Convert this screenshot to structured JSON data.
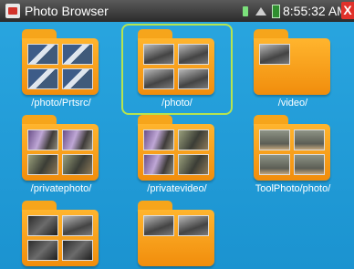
{
  "window": {
    "title": "Photo Browser",
    "clock": "8:55:32 AM",
    "close_label": "X"
  },
  "status_icons": [
    "sd-card-icon",
    "network-icon",
    "battery-icon"
  ],
  "colors": {
    "background": "#1e9ad6",
    "folder": "#f6a51b",
    "selection": "#b6e44f",
    "titlebar": "#3a3a3a",
    "close": "#e0312a"
  },
  "folders": [
    {
      "label": "/photo/Prtsrc/",
      "selected": false,
      "thumbs": [
        "screen",
        "screen",
        "screen",
        "screen"
      ]
    },
    {
      "label": "/photo/",
      "selected": true,
      "thumbs": [
        "cctv",
        "cctv",
        "cctv",
        "cctv"
      ]
    },
    {
      "label": "/video/",
      "selected": false,
      "thumbs": [
        "cctv"
      ]
    },
    {
      "label": "/privatephoto/",
      "selected": false,
      "thumbs": [
        "purple",
        "purple",
        "room",
        "room"
      ]
    },
    {
      "label": "/privatevideo/",
      "selected": false,
      "thumbs": [
        "purple",
        "room",
        "purple",
        "room"
      ]
    },
    {
      "label": "ToolPhoto/photo/",
      "selected": false,
      "thumbs": [
        "wall",
        "wall",
        "wall",
        "wall"
      ]
    },
    {
      "label": "",
      "selected": false,
      "thumbs": [
        "dark",
        "cctv",
        "dark",
        "dark"
      ]
    },
    {
      "label": "",
      "selected": false,
      "thumbs": [
        "cctv",
        "cctv"
      ]
    }
  ]
}
